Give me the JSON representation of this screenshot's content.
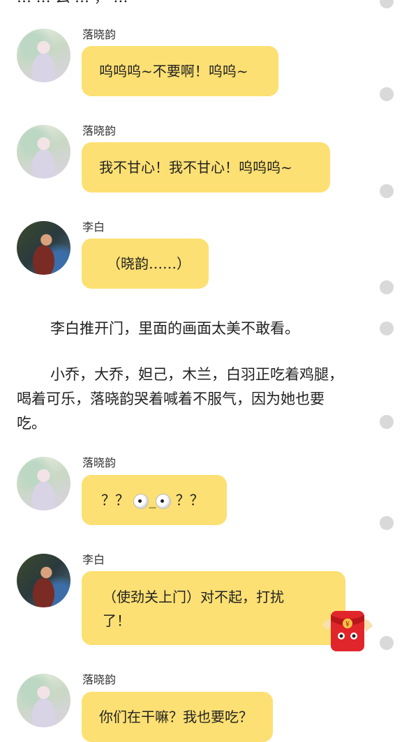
{
  "top_partial_text": "…  … 么 … ， …",
  "messages": [
    {
      "sender": "落晓韵",
      "text": "呜呜呜~不要啊！呜呜~"
    },
    {
      "sender": "落晓韵",
      "text": "我不甘心！我不甘心！呜呜呜~"
    },
    {
      "sender": "李白",
      "text": "（晓韵……）"
    },
    {
      "sender": "落晓韵",
      "text_before": "？？",
      "text_mid": "_",
      "text_after": "？？"
    },
    {
      "sender": "李白",
      "line1": "（使劲关上门）对不起，打扰",
      "line2": "了！"
    },
    {
      "sender": "落晓韵",
      "text": "你们在干嘛？我也要吃？"
    }
  ],
  "narration": [
    "李白推开门，里面的画面太美不敢看。",
    "小乔，大乔，妲己，木兰，白羽正吃着鸡腿，",
    "喝着可乐，落晓韵哭着喊着不服气，因为她也要",
    "吃。"
  ],
  "icons": {
    "avatar_luo": "girl-avatar",
    "avatar_li": "warrior-avatar",
    "more": "gray-dot",
    "red_packet": "red-envelope"
  },
  "colors": {
    "bubble": "#fde073",
    "dot": "#d9d9d9",
    "red": "#e0262b"
  }
}
